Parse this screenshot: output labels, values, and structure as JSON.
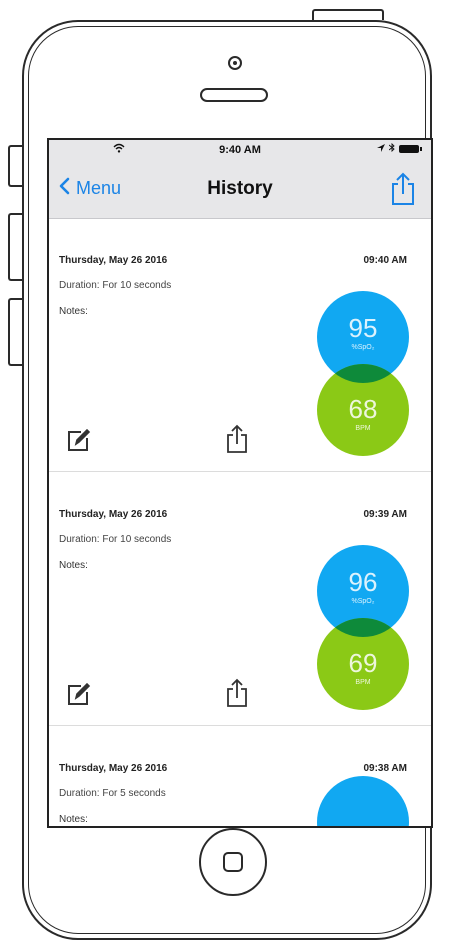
{
  "status_bar": {
    "time": "9:40 AM"
  },
  "nav": {
    "back_label": "Menu",
    "title": "History"
  },
  "entries": [
    {
      "date": "Thursday, May 26 2016",
      "time": "09:40 AM",
      "duration": "Duration: For 10 seconds",
      "notes_label": "Notes:",
      "spo2_value": "95",
      "spo2_unit": "%SpO₂",
      "bpm_value": "68",
      "bpm_unit": "BPM"
    },
    {
      "date": "Thursday, May 26 2016",
      "time": "09:39 AM",
      "duration": "Duration: For 10 seconds",
      "notes_label": "Notes:",
      "spo2_value": "96",
      "spo2_unit": "%SpO₂",
      "bpm_value": "69",
      "bpm_unit": "BPM"
    },
    {
      "date": "Thursday, May 26 2016",
      "time": "09:38 AM",
      "duration": "Duration: For 5 seconds",
      "notes_label": "Notes:"
    }
  ],
  "colors": {
    "spo2": "#11a8f2",
    "bpm": "#8bc916",
    "overlap": "#0e8a3a",
    "accent": "#1b84e6"
  },
  "icons": {
    "nav_share": "share-icon",
    "edit": "edit-icon",
    "entry_share": "share-icon"
  }
}
